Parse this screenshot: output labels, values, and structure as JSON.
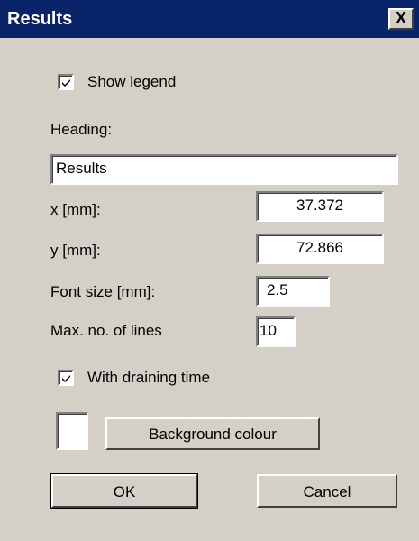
{
  "window": {
    "title": "Results",
    "close_label": "X"
  },
  "show_legend": {
    "checked": true,
    "label": "Show legend"
  },
  "heading": {
    "label": "Heading:",
    "value": "Results"
  },
  "x_field": {
    "label": "x [mm]:",
    "value": "37.372"
  },
  "y_field": {
    "label": "y [mm]:",
    "value": "72.866"
  },
  "font_size": {
    "label": "Font size [mm]:",
    "value": "2.5"
  },
  "max_lines": {
    "label": "Max. no. of lines",
    "value": "10"
  },
  "draining_time": {
    "checked": true,
    "label": "With draining time"
  },
  "background": {
    "swatch_color": "#ffffff",
    "button_label": "Background colour"
  },
  "buttons": {
    "ok_label": "OK",
    "cancel_label": "Cancel"
  },
  "colors": {
    "titlebar": "#0a246a",
    "dialog_face": "#d4d0c8"
  }
}
